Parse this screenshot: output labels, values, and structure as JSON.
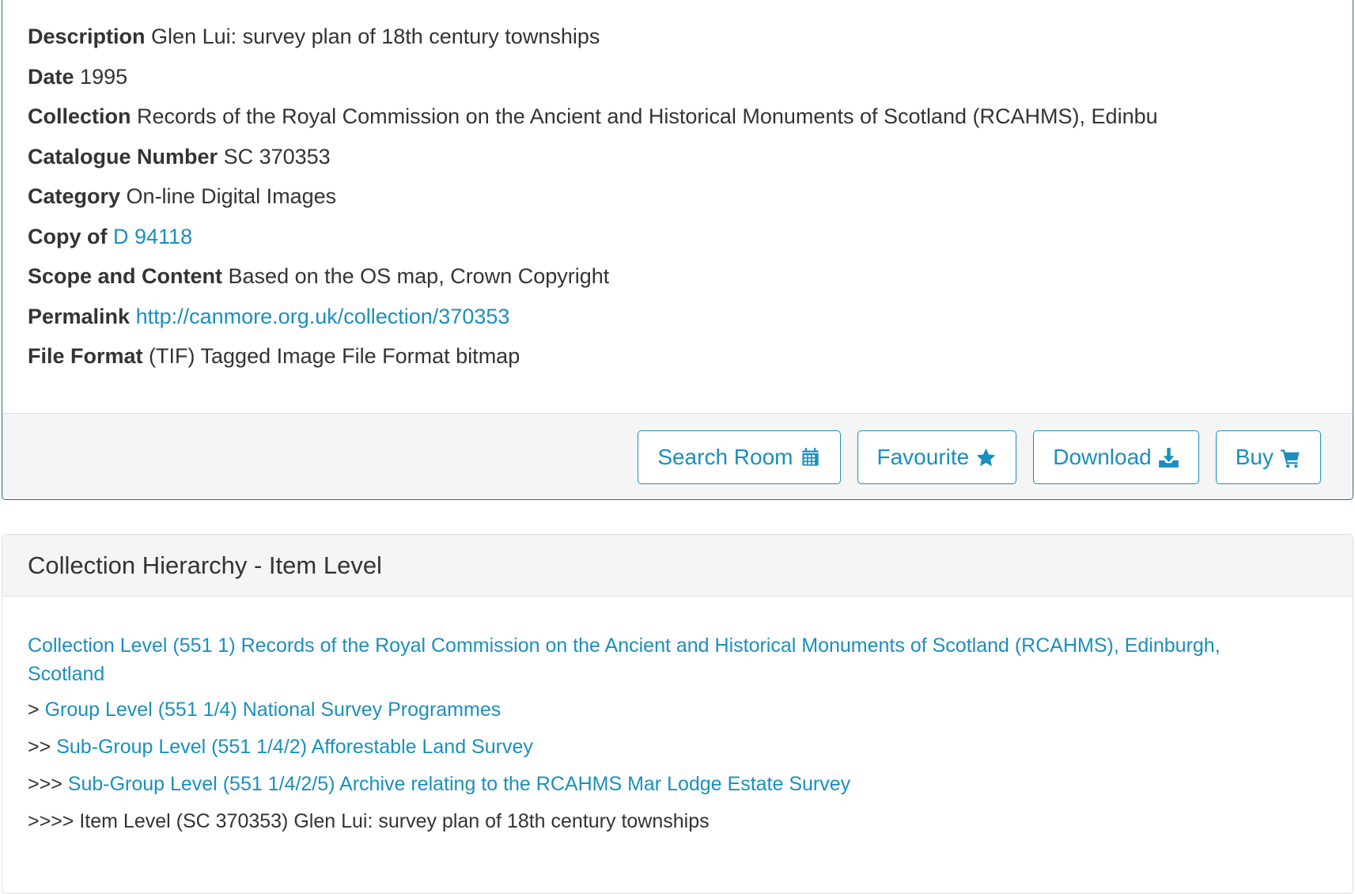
{
  "metadata": [
    {
      "label": "Description",
      "value": "Glen Lui: survey plan of 18th century townships",
      "link": false
    },
    {
      "label": "Date",
      "value": "1995",
      "link": false
    },
    {
      "label": "Collection",
      "value": "Records of the Royal Commission on the Ancient and Historical Monuments of Scotland (RCAHMS), Edinbu",
      "link": false
    },
    {
      "label": "Catalogue Number",
      "value": "SC 370353",
      "link": false
    },
    {
      "label": "Category",
      "value": "On-line Digital Images",
      "link": false
    },
    {
      "label": "Copy of",
      "value": "D 94118",
      "link": true
    },
    {
      "label": "Scope and Content",
      "value": "Based on the OS map, Crown Copyright",
      "link": false
    },
    {
      "label": "Permalink",
      "value": "http://canmore.org.uk/collection/370353",
      "link": true
    },
    {
      "label": "File Format",
      "value": "(TIF) Tagged Image File Format bitmap",
      "link": false
    }
  ],
  "buttons": [
    {
      "label": "Search Room",
      "icon": "calendar-icon",
      "name": "search-room-button"
    },
    {
      "label": "Favourite",
      "icon": "star-icon",
      "name": "favourite-button"
    },
    {
      "label": "Download",
      "icon": "download-icon",
      "name": "download-button"
    },
    {
      "label": "Buy",
      "icon": "cart-icon",
      "name": "buy-button"
    }
  ],
  "hierarchy": {
    "title": "Collection Hierarchy - Item Level",
    "collection_level": "Collection Level (551 1) Records of the Royal Commission on the Ancient and Historical Monuments of Scotland (RCAHMS), Edinburgh, Scotland",
    "levels": [
      {
        "prefix": ">",
        "text": "Group Level (551 1/4) National Survey Programmes",
        "link": true
      },
      {
        "prefix": ">>",
        "text": "Sub-Group Level (551 1/4/2) Afforestable Land Survey",
        "link": true
      },
      {
        "prefix": ">>>",
        "text": "Sub-Group Level (551 1/4/2/5) Archive relating to the RCAHMS Mar Lodge Estate Survey",
        "link": true
      },
      {
        "prefix": ">>>>",
        "text": "Item Level (SC 370353) Glen Lui: survey plan of 18th century townships",
        "link": false
      }
    ]
  },
  "colors": {
    "link": "#1a8fbf",
    "border": "#2a6b83",
    "text": "#333333",
    "footer_bg": "#f5f5f5"
  }
}
